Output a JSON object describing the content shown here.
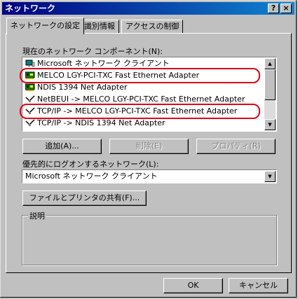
{
  "window": {
    "title": "ネットワーク",
    "help_btn": "?",
    "close_btn": "×"
  },
  "tabs": [
    {
      "label": "ネットワークの設定",
      "active": true
    },
    {
      "label": "識別情報",
      "active": false
    },
    {
      "label": "アクセスの制御",
      "active": false
    }
  ],
  "components": {
    "label": "現在のネットワーク コンポーネント(N):",
    "items": [
      {
        "text": "Microsoft ネットワーク クライアント",
        "icon": "client-icon",
        "highlighted": false
      },
      {
        "text": "MELCO LGY-PCI-TXC Fast Ethernet Adapter",
        "icon": "adapter-icon",
        "highlighted": true
      },
      {
        "text": "NDIS 1394 Net Adapter",
        "icon": "adapter-icon",
        "highlighted": false
      },
      {
        "text": "NetBEUI -> MELCO LGY-PCI-TXC Fast Ethernet Adapter",
        "icon": "protocol-icon",
        "highlighted": false
      },
      {
        "text": "TCP/IP -> MELCO LGY-PCI-TXC Fast Ethernet Adapter",
        "icon": "protocol-icon",
        "highlighted": true
      },
      {
        "text": "TCP/IP -> NDIS 1394 Net Adapter",
        "icon": "protocol-icon",
        "highlighted": false
      }
    ]
  },
  "buttons": {
    "add": "追加(A)...",
    "remove": "削除(E)",
    "properties": "プロパティ(R)",
    "file_print": "ファイルとプリンタの共有(F)...",
    "ok": "OK",
    "cancel": "キャンセル"
  },
  "logon": {
    "label": "優先的にログオンするネットワーク(L):",
    "value": "Microsoft ネットワーク クライアント"
  },
  "description": {
    "legend": "説明"
  },
  "colors": {
    "highlight": "#e0001b",
    "title_bar": "#000080",
    "face": "#c0c0c0"
  }
}
